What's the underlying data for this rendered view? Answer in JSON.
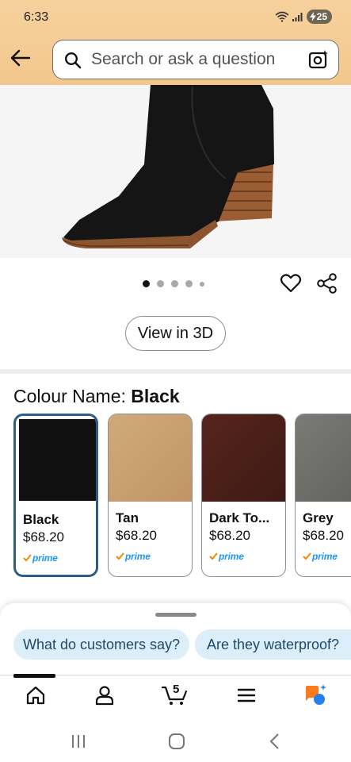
{
  "status_bar": {
    "time": "6:33",
    "battery": "25"
  },
  "search": {
    "placeholder": "Search or ask a question"
  },
  "gallery": {
    "dot_count": 5,
    "active_index": 0
  },
  "buttons": {
    "view_3d": "View in 3D"
  },
  "colour": {
    "label_prefix": "Colour Name: ",
    "selected": "Black",
    "options": [
      {
        "name": "Black",
        "price": "$68.20",
        "badge": "prime",
        "color": "#111111"
      },
      {
        "name": "Tan",
        "price": "$68.20",
        "badge": "prime",
        "color": "#c9a06e"
      },
      {
        "name": "Dark To...",
        "price": "$68.20",
        "badge": "prime",
        "color": "#4b2019"
      },
      {
        "name": "Grey",
        "price": "$68.20",
        "badge": "prime",
        "color": "#6f6f6c"
      }
    ]
  },
  "suggestions": [
    "What do customers say?",
    "Are they waterproof?"
  ],
  "bottom_nav": {
    "items": [
      "home-icon",
      "account-icon",
      "cart-icon",
      "menu-icon",
      "rufus-icon"
    ],
    "cart_count": "5"
  },
  "colors": {
    "header_bg": "#f3c78d",
    "selected_border": "#2a5d8a",
    "chip_bg": "#dbeef9",
    "prime_blue": "#1a98ff",
    "rufus_orange": "#ff7a1a",
    "rufus_blue": "#2680eb"
  }
}
